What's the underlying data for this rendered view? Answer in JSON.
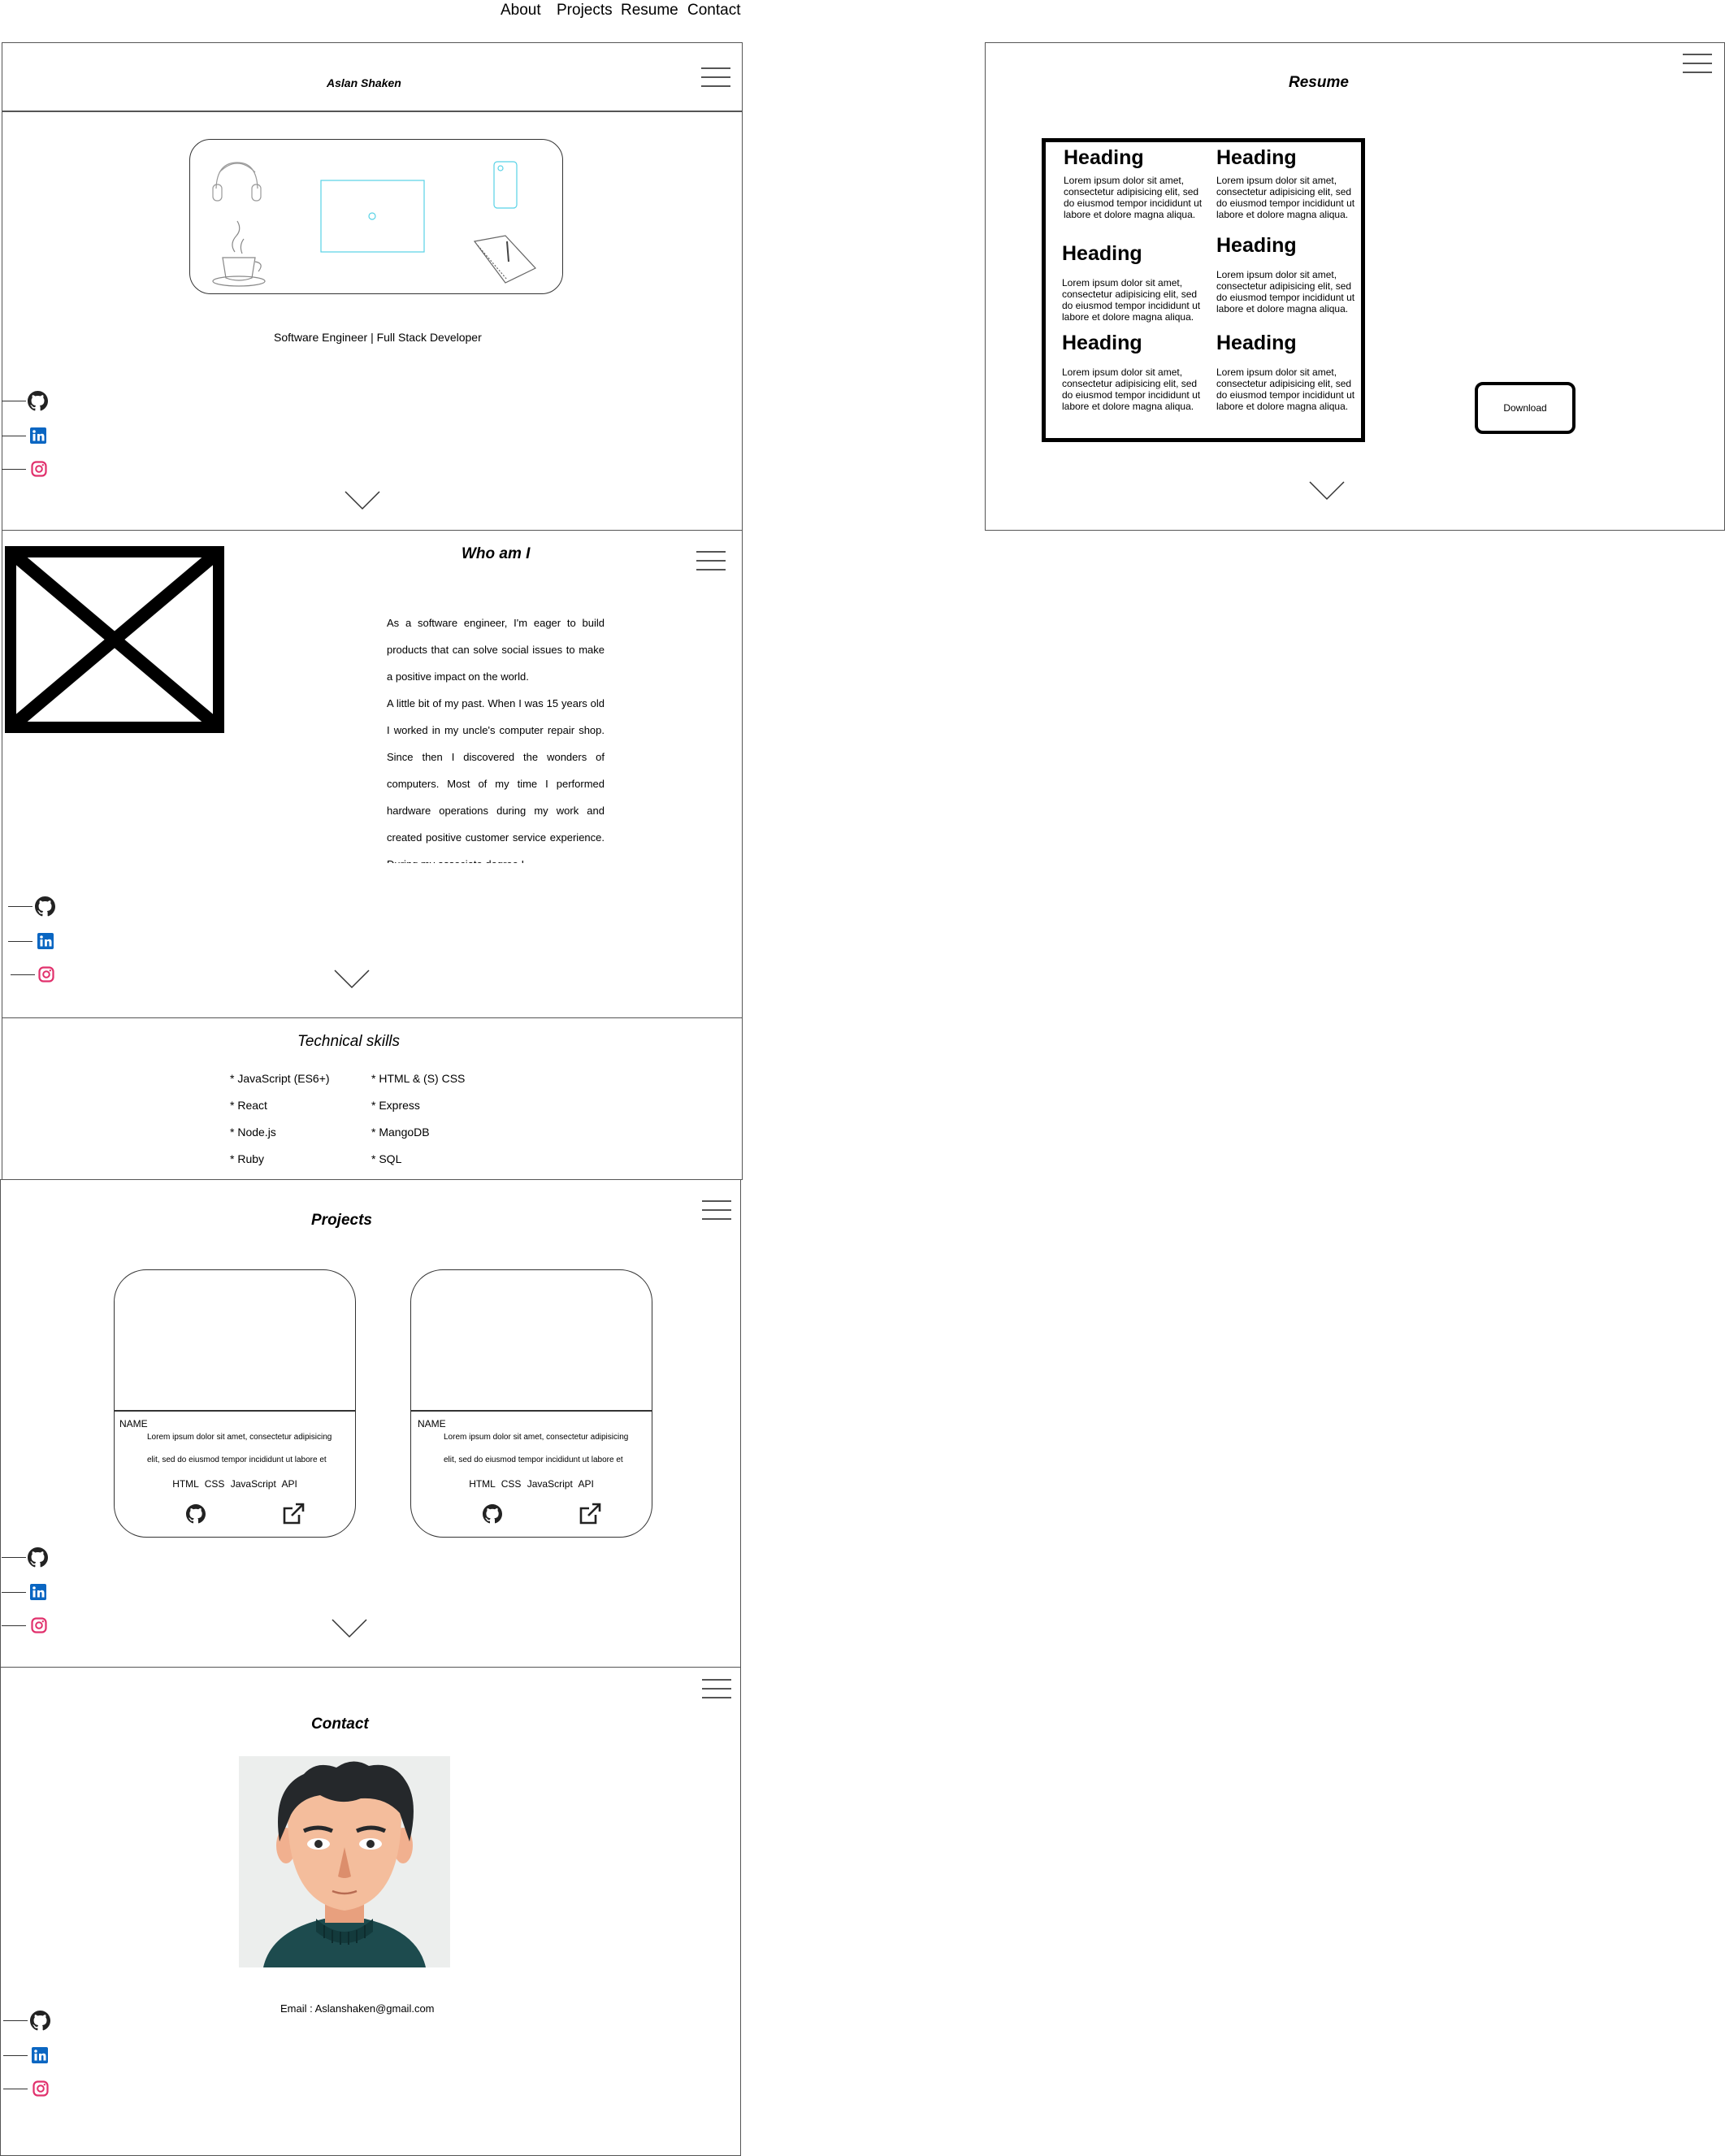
{
  "nav": {
    "about": "About",
    "projects": "Projects",
    "resume": "Resume",
    "contact": "Contact"
  },
  "home": {
    "name": "Aslan Shaken",
    "tagline": "Software Engineer | Full Stack Developer"
  },
  "about": {
    "title": "Who am I",
    "para1": "As a software engineer, I'm eager to build products that can solve social issues to make a positive impact on the world.",
    "para2": " A little bit of my past. When I was 15 years old I worked in my uncle's computer repair shop. Since then I discovered the wonders of computers. Most of my time I performed hardware operations during my work and created positive customer service experience. During my associate degree I"
  },
  "skills": {
    "title": "Technical skills",
    "col1": [
      "*  JavaScript (ES6+)",
      "* React",
      "* Node.js",
      "* Ruby"
    ],
    "col2": [
      "* HTML & (S) CSS",
      "* Express",
      " * MangoDB",
      " * SQL"
    ]
  },
  "projects": {
    "title": "Projects",
    "cards": [
      {
        "name": "NAME",
        "desc": "Lorem ipsum dolor sit amet, consectetur adipisicing elit, sed do eiusmod tempor incididunt ut labore et",
        "tags": "HTML  CSS  JavaScript  API"
      },
      {
        "name": "NAME",
        "desc": "Lorem ipsum dolor sit amet, consectetur adipisicing elit, sed do eiusmod tempor incididunt ut labore et",
        "tags": "HTML  CSS  JavaScript  API"
      }
    ]
  },
  "contact": {
    "title": "Contact",
    "email": "Email : Aslanshaken@gmail.com"
  },
  "resume": {
    "title": "Resume",
    "sections": [
      {
        "heading": "Heading",
        "text": "Lorem ipsum dolor sit amet, consectetur adipisicing elit, sed do eiusmod tempor incididunt ut labore et dolore magna aliqua."
      },
      {
        "heading": "Heading",
        "text": "Lorem ipsum dolor sit amet, consectetur adipisicing elit, sed do eiusmod tempor incididunt ut labore et dolore magna aliqua."
      },
      {
        "heading": "Heading",
        "text": "Lorem ipsum dolor sit amet, consectetur adipisicing elit, sed do eiusmod tempor incididunt ut labore et dolore magna aliqua."
      },
      {
        "heading": "Heading",
        "text": "Lorem ipsum dolor sit amet, consectetur adipisicing elit, sed do eiusmod tempor incididunt ut labore et dolore magna aliqua."
      },
      {
        "heading": "Heading",
        "text": "Lorem ipsum dolor sit amet, consectetur adipisicing elit, sed do eiusmod tempor incididunt ut labore et dolore magna aliqua."
      },
      {
        "heading": "Heading",
        "text": "Lorem ipsum dolor sit amet, consectetur adipisicing elit, sed do eiusmod tempor incididunt ut labore et dolore magna aliqua."
      }
    ],
    "download": "Download"
  },
  "colors": {
    "linkedin": "#0a66c2",
    "instagram": "#e1306c",
    "laptop": "#58d2e6"
  }
}
